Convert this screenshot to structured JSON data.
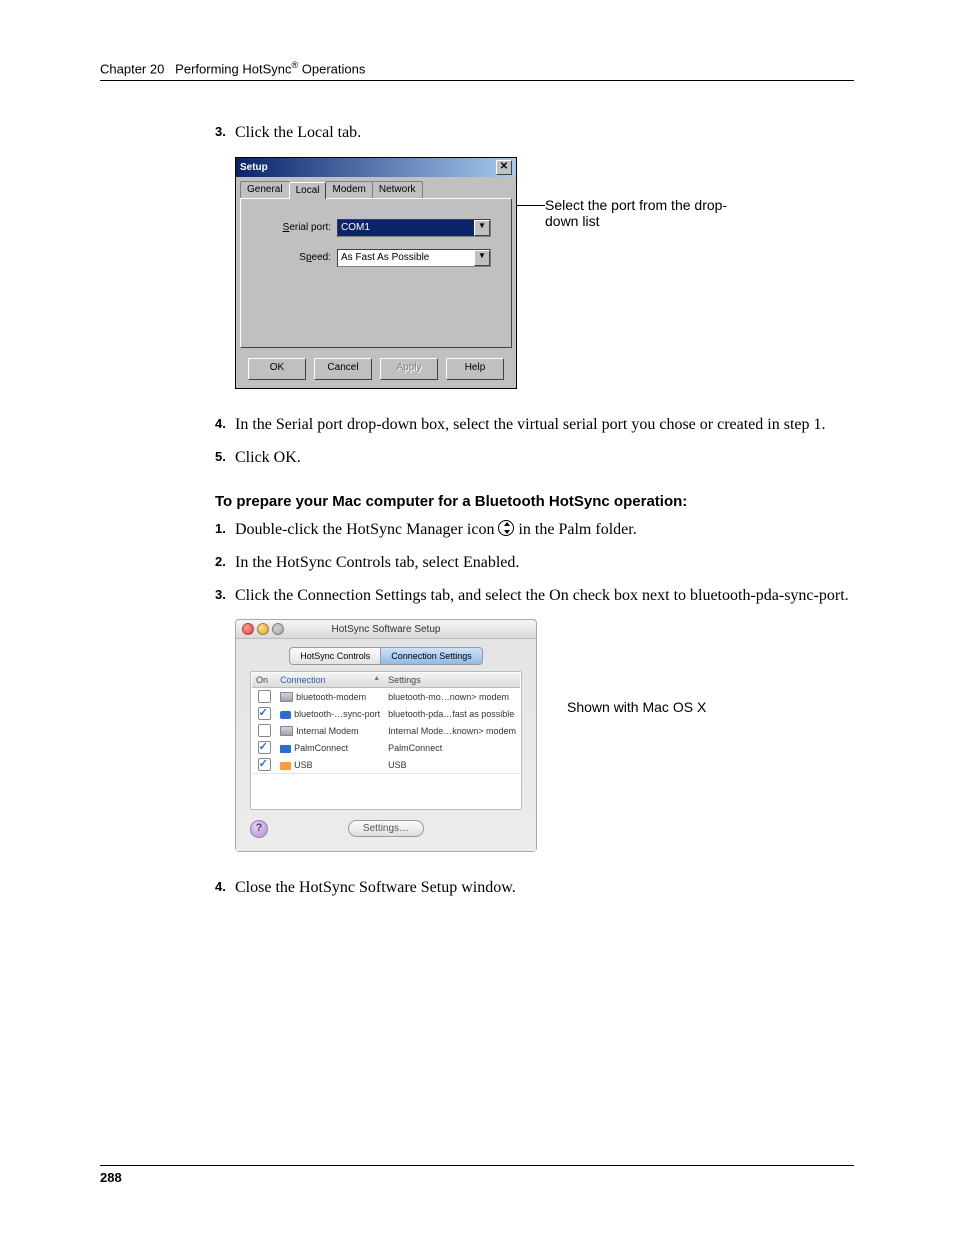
{
  "chapterLine": {
    "prefix": "Chapter 20",
    "title": "Performing HotSync",
    "suffix": " Operations",
    "reg": "®"
  },
  "steps_a": [
    {
      "num": "3.",
      "text": "Click the Local tab."
    }
  ],
  "callout1": "Select the port from the drop-down list",
  "setup": {
    "title": "Setup",
    "tabs": [
      "General",
      "Local",
      "Modem",
      "Network"
    ],
    "serialLabel": "Serial port:",
    "serialValue": "COM1",
    "speedLabel": "Speed:",
    "speedValue": "As Fast As Possible",
    "buttons": {
      "ok": "OK",
      "cancel": "Cancel",
      "apply": "Apply",
      "help": "Help"
    }
  },
  "steps_b": [
    {
      "num": "4.",
      "text": "In the Serial port drop-down box, select the virtual serial port you chose or created in step 1."
    },
    {
      "num": "5.",
      "text": "Click OK."
    }
  ],
  "subhead": "To prepare your Mac computer for a Bluetooth HotSync operation:",
  "steps_c": [
    {
      "num": "1.",
      "text_pre": "Double-click the HotSync Manager icon ",
      "text_post": " in the Palm folder.",
      "icon": true
    },
    {
      "num": "2.",
      "text": "In the HotSync Controls tab, select Enabled."
    },
    {
      "num": "3.",
      "text": "Click the Connection Settings tab, and select the On check box next to bluetooth-pda-sync-port."
    }
  ],
  "mac": {
    "title": "HotSync Software Setup",
    "tabs": [
      "HotSync Controls",
      "Connection Settings"
    ],
    "headers": [
      "On",
      "Connection",
      "Settings"
    ],
    "rows": [
      {
        "checked": false,
        "icon": "serial",
        "conn": "bluetooth-modem",
        "set": "bluetooth-mo…nown> modem"
      },
      {
        "checked": true,
        "icon": "bt",
        "conn": "bluetooth-…sync-port",
        "set": "bluetooth-pda…fast as possible"
      },
      {
        "checked": false,
        "icon": "serial",
        "conn": "Internal Modem",
        "set": "Internal Mode…known> modem"
      },
      {
        "checked": true,
        "icon": "plug",
        "conn": "PalmConnect",
        "set": "PalmConnect"
      },
      {
        "checked": true,
        "icon": "usb",
        "conn": "USB",
        "set": "USB"
      }
    ],
    "settingsBtn": "Settings…",
    "help": "?"
  },
  "callout2": "Shown with Mac OS X",
  "steps_d": [
    {
      "num": "4.",
      "text": "Close the HotSync Software Setup window."
    }
  ],
  "pageNumber": "288"
}
